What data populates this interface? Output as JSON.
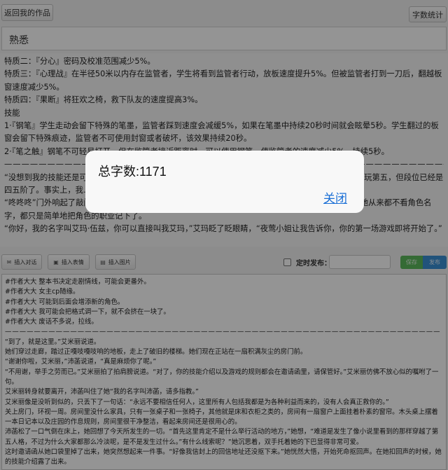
{
  "header": {
    "back_label": "返回我的作品",
    "word_count_label": "字数统计"
  },
  "work_title": "熟悉",
  "preview_lines": [
    "特质二：『分心』密码及校准范围减少5%。",
    "特质三：『心理战』在半径50米以内存在监管者，学生将看到监管者行动，放板速度提升5%。但被监管者打到一刀后，翻越板窗速度减少5%。",
    "特质四：『果断』将狂欢之椅，救下队友的速度提高3%。",
    "技能",
    "1·『钢笔』学生走动会留下特殊的笔墨，监管者踩到速度会减缓5%，如果在笔墨中持续20秒时间就会眩晕5秒。学生翻过的板窗会留下特殊痕迹，监管者不可使用封窗或者破坏，该效果持续20秒。",
    "2·『笔之触』钢笔不可轻易打开，但在监管者接近距离时，可以使用钢笔，使监管者的速度减少5%，持续5秒。",
    "————————————————————————————————————————————————————————————",
    "“没想到我的技能还是可以，不过这个游戏角色还是有点多，天天练习也不知道练多久，这次我就要怎么玩第五，但段位已经是四五阶了。事实上，我……”",
    "“咚咚咚”门外响起了敲门声，打断了我的思绪。我打开门，门外站着一个女孩，她笑着跟我打招呼，但她从来都不看角色名字，都只是简单地把角色的职业记下了。",
    "“你好，我的名字叫艾玛·伍兹，你可以直接叫我艾玛，”艾玛眨了眨眼睛，“夜莺小姐让我告诉你，你的第一场游戏即将开始了。”"
  ],
  "toolbar": {
    "insert_dialog": "插入对话",
    "insert_emoji": "插入表情",
    "insert_image": "插入图片",
    "schedule_label": "定时发布：",
    "save_label": "保存",
    "publish_label": "发布"
  },
  "editor_lines": [
    "#作者大大 整本书决定走剧情线，可能会更番外。",
    "#作者大大 女主cp随缘。",
    "#作者大大 可能到后面会增添新的角色。",
    "#作者大大 我可能会把格式调一下，就不会挤在一块了。",
    "#作者大大 废话不多说，拉线。",
    "————————————————————————————————————————————————————————————",
    "“到了，就是这里。”艾米丽说道。",
    "她们穿过走廊，踏过正嘎吱嘎吱响的地板，走上了破旧的楼梯。她们现在正站在一扇积满灰尘的房门前。",
    "“谢谢你啦，艾米丽，”沛菡说道，“真是麻烦你了呢。”",
    "“不用谢，举手之劳而已。”艾米丽拍了拍肩膀说道。“对了，你的技能介绍以及游戏的规则都会在邀请函里，请保管好。”艾米丽仿佛不放心似的嘱咐了一句。",
    "艾米丽转身就要离开，沛菡叫住了她“我的名字叫沛菡，请多指教。”",
    "艾米丽像是没听到似的，只丢下了一句话：“永远不要相信任何人，这里所有人包括我都是为各种利益而来的，没有人会真正救你的。”",
    "关上房门，环视一周。房间里没什么家具，只有一张桌子和一张椅子，其他就是床和衣柜之类的，房间有一扇窗户上面挂着朴素的窗帘。木头桌上摆着一本日记本以及庄园的作息规则，房间里很干净整洁，看起来房间还是很用心的。",
    "沛菡松了一口气倒在床上，她回想了今天所发生的一切。“首先这里肯定不是什么举行活动的地方，”她想，“难道是发生了像小说里看到的那样穿越了第五人格，不过为什么大家都那么冷淡呢，是不是发生过什么。”有什么线索呢？”她沉思着，双手托着她的下巴显得非常可爱。",
    "这时邀请函从她口袋里掉了出来，她突然想起来一件事。“好像我信封上的回信地址还没抠下来。”她恍然大悟，开始死命抠回声。在她扣回声的时候，她的技能介绍露了出来。"
  ],
  "modal": {
    "title": "总字数:1171",
    "close_label": "关闭"
  },
  "colors": {
    "save": "#5cb85c",
    "publish": "#3a8fd4",
    "link": "#1a6fd6"
  }
}
